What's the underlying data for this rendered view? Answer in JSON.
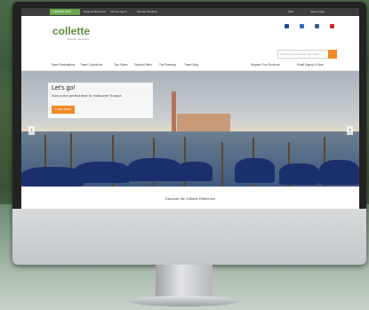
{
  "topbar": {
    "phone": "1.800.581.8942",
    "links": [
      "Request Brochures",
      "Find an Agent",
      "Manage Booking"
    ],
    "right": [
      "USD",
      "Agent Login"
    ]
  },
  "header": {
    "logo": "collette",
    "logo_sub": "Explore the World",
    "search_placeholder": "Search by Destination, Tour Name"
  },
  "nav": {
    "items": [
      "Travel Destinations",
      "Travel Collections",
      "Tour Styles",
      "Special Offers",
      "Trip Planning",
      "Travel Blog"
    ],
    "right": [
      "Request Tour Brochure",
      "Email Signup & Save"
    ]
  },
  "hero": {
    "headline": "Let's go!",
    "subtext": "Now is the perfect time to rediscover Europe",
    "button": "Learn More"
  },
  "footer": {
    "discover": "Discover the Collette Difference"
  },
  "colors": {
    "accent": "#f08a24",
    "brand_green": "#5a8f3a",
    "topbar": "#3d3d3d"
  }
}
